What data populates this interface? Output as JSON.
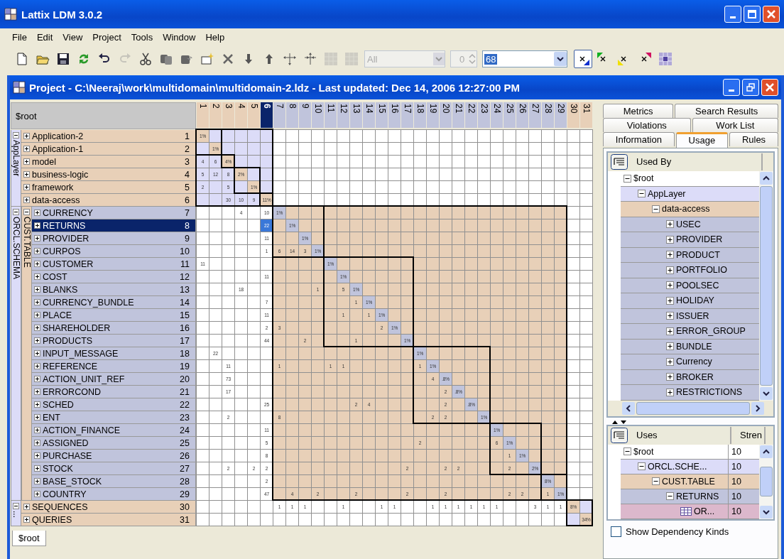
{
  "window": {
    "title": "Lattix LDM 3.0.2"
  },
  "menu": [
    "File",
    "Edit",
    "View",
    "Project",
    "Tools",
    "Window",
    "Help"
  ],
  "toolbar": [
    {
      "kind": "new",
      "disabled": false
    },
    {
      "kind": "open",
      "disabled": false
    },
    {
      "kind": "save",
      "disabled": false
    },
    {
      "kind": "refresh",
      "disabled": false
    },
    {
      "kind": "undo",
      "disabled": false
    },
    {
      "kind": "redo",
      "disabled": true
    },
    {
      "kind": "cut",
      "disabled": false
    },
    {
      "kind": "copy",
      "disabled": false
    },
    {
      "kind": "paste",
      "disabled": false
    },
    {
      "kind": "create",
      "disabled": false
    },
    {
      "kind": "delete",
      "disabled": false
    },
    {
      "kind": "down",
      "disabled": false
    },
    {
      "kind": "up",
      "disabled": false
    },
    {
      "kind": "spread",
      "disabled": false
    },
    {
      "kind": "squeeze",
      "disabled": false
    },
    {
      "kind": "grid",
      "disabled": true
    },
    {
      "kind": "grid",
      "disabled": true
    }
  ],
  "filter": {
    "value": "All",
    "disabled": true
  },
  "spinner": {
    "value": "0",
    "disabled": true
  },
  "combo": {
    "value": "68"
  },
  "marks": [
    {
      "kind": "blue",
      "pressed": true
    },
    {
      "kind": "green",
      "pressed": false
    },
    {
      "kind": "yellow",
      "pressed": false
    },
    {
      "kind": "pink",
      "pressed": false
    },
    {
      "kind": "partition",
      "pressed": false
    }
  ],
  "project_window": {
    "title": "Project - C:\\Neeraj\\work\\multidomain\\multidomain-2.ldz - Last updated: Dec 14, 2006 12:27:00 PM"
  },
  "matrix": {
    "root_label": "$root",
    "columns": [
      {
        "label": "1",
        "selected": false
      },
      {
        "label": "2",
        "selected": false
      },
      {
        "label": "3",
        "selected": false
      },
      {
        "label": "4",
        "selected": false
      },
      {
        "label": "5",
        "selected": false
      },
      {
        "label": "6",
        "selected": true
      },
      {
        "label": "7",
        "selected": false
      },
      {
        "label": "8",
        "selected": false
      },
      {
        "label": "9",
        "selected": false
      },
      {
        "label": "10",
        "selected": false
      },
      {
        "label": "11",
        "selected": false
      },
      {
        "label": "12",
        "selected": false
      },
      {
        "label": "13",
        "selected": false
      },
      {
        "label": "14",
        "selected": false
      },
      {
        "label": "15",
        "selected": false
      },
      {
        "label": "16",
        "selected": false
      },
      {
        "label": "17",
        "selected": false
      },
      {
        "label": "18",
        "selected": false
      },
      {
        "label": "19",
        "selected": false
      },
      {
        "label": "20",
        "selected": false
      },
      {
        "label": "21",
        "selected": false
      },
      {
        "label": "22",
        "selected": false
      },
      {
        "label": "23",
        "selected": false
      },
      {
        "label": "24",
        "selected": false
      },
      {
        "label": "25",
        "selected": false
      },
      {
        "label": "26",
        "selected": false
      },
      {
        "label": "27",
        "selected": false
      },
      {
        "label": "28",
        "selected": false
      },
      {
        "label": "29",
        "selected": false
      },
      {
        "label": "30",
        "selected": false
      },
      {
        "label": "31",
        "selected": false
      }
    ],
    "groups": [
      {
        "label": "AppLayer",
        "expanded": true,
        "blocks": [
          {
            "rows": [
              {
                "name": "Application-2",
                "number": "1",
                "selected": false,
                "expanded": false,
                "cells": [
                  "1%"
                ]
              },
              {
                "name": "Application-1",
                "number": "2",
                "selected": false,
                "expanded": false,
                "cells": [
                  null,
                  "1%"
                ]
              }
            ]
          },
          {
            "rows": [
              {
                "name": "model",
                "number": "3",
                "selected": false,
                "expanded": false,
                "cells": [
                  "4",
                  "6",
                  "4%"
                ]
              }
            ]
          },
          {
            "rows": [
              {
                "name": "business-logic",
                "number": "4",
                "selected": false,
                "expanded": false,
                "cells": [
                  "5",
                  "12",
                  "8",
                  "2%"
                ]
              },
              {
                "name": "framework",
                "number": "5",
                "selected": false,
                "expanded": false,
                "cells": [
                  "2",
                  null,
                  "5",
                  null,
                  "1%"
                ]
              }
            ]
          },
          {
            "rows": [
              {
                "name": "data-access",
                "number": "6",
                "selected": false,
                "expanded": false,
                "cells": [
                  null,
                  null,
                  "30",
                  "10",
                  "9",
                  "11%"
                ]
              }
            ]
          }
        ]
      },
      {
        "label": "ORCL.SCHEMA",
        "expanded": true,
        "children": [
          {
            "label": "CUST.TABLE",
            "expanded": true,
            "blocks": [
              {
                "rows": [
                  {
                    "name": "CURRENCY",
                    "number": "7",
                    "selected": false,
                    "expanded": false,
                    "cells": [
                      null,
                      null,
                      null,
                      "4",
                      null,
                      "10",
                      "1%"
                    ]
                  },
                  {
                    "name": "RETURNS",
                    "number": "8",
                    "selected": true,
                    "expanded": false,
                    "cells": [
                      null,
                      null,
                      null,
                      null,
                      null,
                      "22",
                      null,
                      "1%"
                    ]
                  },
                  {
                    "name": "PROVIDER",
                    "number": "9",
                    "selected": false,
                    "expanded": false,
                    "cells": [
                      null,
                      null,
                      null,
                      null,
                      null,
                      "11",
                      null,
                      null,
                      "1%"
                    ]
                  },
                  {
                    "name": "CURPOS",
                    "number": "10",
                    "selected": false,
                    "expanded": false,
                    "cells": [
                      null,
                      null,
                      null,
                      null,
                      null,
                      "1",
                      "6",
                      "14",
                      "3",
                      "1%"
                    ]
                  }
                ]
              },
              {
                "rows": [
                  {
                    "name": "CUSTOMER",
                    "number": "11",
                    "selected": false,
                    "expanded": false,
                    "cells": [
                      "11",
                      null,
                      null,
                      null,
                      null,
                      null,
                      null,
                      null,
                      null,
                      null,
                      "1%"
                    ]
                  },
                  {
                    "name": "COST",
                    "number": "12",
                    "selected": false,
                    "expanded": false,
                    "cells": [
                      null,
                      null,
                      null,
                      null,
                      null,
                      "11",
                      null,
                      null,
                      null,
                      null,
                      null,
                      "1%"
                    ]
                  },
                  {
                    "name": "BLANKS",
                    "number": "13",
                    "selected": false,
                    "expanded": false,
                    "cells": [
                      null,
                      null,
                      null,
                      "18",
                      null,
                      null,
                      null,
                      null,
                      null,
                      "1",
                      null,
                      "5",
                      "1%"
                    ]
                  },
                  {
                    "name": "CURRENCY_BUNDLE",
                    "number": "14",
                    "selected": false,
                    "expanded": false,
                    "cells": [
                      null,
                      null,
                      null,
                      null,
                      null,
                      "7",
                      null,
                      null,
                      null,
                      null,
                      null,
                      null,
                      "1",
                      "1%"
                    ]
                  },
                  {
                    "name": "PLACE",
                    "number": "15",
                    "selected": false,
                    "expanded": false,
                    "cells": [
                      null,
                      null,
                      null,
                      null,
                      null,
                      "11",
                      null,
                      null,
                      null,
                      null,
                      null,
                      "1",
                      null,
                      "1",
                      "1%"
                    ]
                  },
                  {
                    "name": "SHAREHOLDER",
                    "number": "16",
                    "selected": false,
                    "expanded": false,
                    "cells": [
                      null,
                      null,
                      null,
                      null,
                      null,
                      "2",
                      "3",
                      null,
                      null,
                      null,
                      null,
                      null,
                      null,
                      null,
                      "2",
                      "1%"
                    ]
                  },
                  {
                    "name": "PRODUCTS",
                    "number": "17",
                    "selected": false,
                    "expanded": false,
                    "cells": [
                      null,
                      null,
                      null,
                      null,
                      null,
                      "44",
                      null,
                      null,
                      "2",
                      null,
                      null,
                      null,
                      "1",
                      null,
                      null,
                      null,
                      "1%"
                    ]
                  }
                ]
              },
              {
                "rows": [
                  {
                    "name": "INPUT_MESSAGE",
                    "number": "18",
                    "selected": false,
                    "expanded": false,
                    "cells": [
                      null,
                      "22",
                      null,
                      null,
                      null,
                      null,
                      null,
                      null,
                      null,
                      null,
                      null,
                      null,
                      null,
                      null,
                      null,
                      null,
                      null,
                      "1%"
                    ]
                  },
                  {
                    "name": "REFERENCE",
                    "number": "19",
                    "selected": false,
                    "expanded": false,
                    "cells": [
                      null,
                      null,
                      "11",
                      null,
                      null,
                      null,
                      "1",
                      null,
                      null,
                      null,
                      "1",
                      "1",
                      null,
                      null,
                      null,
                      null,
                      null,
                      "1",
                      "1%"
                    ]
                  },
                  {
                    "name": "ACTION_UNIT_REF",
                    "number": "20",
                    "selected": false,
                    "expanded": false,
                    "cells": [
                      null,
                      null,
                      "73",
                      null,
                      null,
                      null,
                      null,
                      null,
                      null,
                      null,
                      null,
                      null,
                      null,
                      null,
                      null,
                      null,
                      null,
                      null,
                      "4",
                      ".8%"
                    ]
                  },
                  {
                    "name": "ERRORCOND",
                    "number": "21",
                    "selected": false,
                    "expanded": false,
                    "cells": [
                      null,
                      null,
                      "17",
                      null,
                      null,
                      null,
                      null,
                      null,
                      null,
                      null,
                      null,
                      null,
                      null,
                      null,
                      null,
                      null,
                      null,
                      null,
                      null,
                      "2",
                      ".8%"
                    ]
                  },
                  {
                    "name": "SCHED",
                    "number": "22",
                    "selected": false,
                    "expanded": false,
                    "cells": [
                      null,
                      null,
                      null,
                      null,
                      null,
                      "25",
                      null,
                      null,
                      null,
                      null,
                      null,
                      null,
                      "2",
                      "4",
                      null,
                      null,
                      null,
                      null,
                      null,
                      "2",
                      null,
                      ".8%"
                    ]
                  },
                  {
                    "name": "ENT",
                    "number": "23",
                    "selected": false,
                    "expanded": false,
                    "cells": [
                      null,
                      null,
                      "2",
                      null,
                      null,
                      null,
                      "8",
                      null,
                      null,
                      null,
                      null,
                      null,
                      null,
                      null,
                      null,
                      null,
                      null,
                      null,
                      "2",
                      "2",
                      null,
                      null,
                      "1%"
                    ]
                  }
                ]
              },
              {
                "rows": [
                  {
                    "name": "ACTION_FINANCE",
                    "number": "24",
                    "selected": false,
                    "expanded": false,
                    "cells": [
                      null,
                      null,
                      null,
                      null,
                      null,
                      "11",
                      null,
                      null,
                      null,
                      null,
                      null,
                      null,
                      null,
                      null,
                      null,
                      null,
                      null,
                      null,
                      null,
                      null,
                      null,
                      null,
                      null,
                      "1%"
                    ]
                  },
                  {
                    "name": "ASSIGNED",
                    "number": "25",
                    "selected": false,
                    "expanded": false,
                    "cells": [
                      null,
                      null,
                      null,
                      null,
                      null,
                      "5",
                      null,
                      null,
                      null,
                      null,
                      null,
                      null,
                      null,
                      null,
                      null,
                      null,
                      null,
                      "2",
                      null,
                      null,
                      null,
                      null,
                      null,
                      "6",
                      "1%"
                    ]
                  },
                  {
                    "name": "PURCHASE",
                    "number": "26",
                    "selected": false,
                    "expanded": false,
                    "cells": [
                      null,
                      null,
                      null,
                      null,
                      null,
                      "8",
                      null,
                      null,
                      null,
                      null,
                      null,
                      null,
                      null,
                      null,
                      null,
                      null,
                      null,
                      null,
                      null,
                      null,
                      null,
                      null,
                      null,
                      null,
                      "1",
                      "1%"
                    ]
                  },
                  {
                    "name": "STOCK",
                    "number": "27",
                    "selected": false,
                    "expanded": false,
                    "cells": [
                      null,
                      null,
                      "2",
                      null,
                      "2",
                      "2",
                      null,
                      null,
                      null,
                      null,
                      null,
                      null,
                      null,
                      null,
                      null,
                      null,
                      "2",
                      null,
                      null,
                      "2",
                      "2",
                      null,
                      null,
                      null,
                      "2",
                      null,
                      "2%"
                    ]
                  }
                ]
              },
              {
                "rows": [
                  {
                    "name": "BASE_STOCK",
                    "number": "28",
                    "selected": false,
                    "expanded": false,
                    "cells": [
                      null,
                      null,
                      null,
                      null,
                      null,
                      "2",
                      null,
                      null,
                      null,
                      null,
                      null,
                      null,
                      null,
                      null,
                      null,
                      null,
                      null,
                      null,
                      null,
                      null,
                      null,
                      null,
                      null,
                      null,
                      null,
                      null,
                      null,
                      "8%"
                    ]
                  },
                  {
                    "name": "COUNTRY",
                    "number": "29",
                    "selected": false,
                    "expanded": false,
                    "cells": [
                      null,
                      null,
                      null,
                      null,
                      null,
                      "47",
                      null,
                      "4",
                      null,
                      "2",
                      null,
                      null,
                      "2",
                      null,
                      null,
                      null,
                      "2",
                      null,
                      null,
                      "2",
                      null,
                      null,
                      null,
                      null,
                      "2",
                      "2",
                      null,
                      "1",
                      "1%"
                    ]
                  }
                ]
              }
            ]
          }
        ]
      },
      {
        "label": "...",
        "expanded": true,
        "blocks": [
          {
            "rows": [
              {
                "name": "SEQUENCES",
                "number": "30",
                "selected": false,
                "expanded": false,
                "cells": [
                  null,
                  null,
                  null,
                  null,
                  null,
                  null,
                  "1",
                  "1",
                  "1",
                  null,
                  null,
                  "1",
                  null,
                  null,
                  "1",
                  "1",
                  null,
                  null,
                  "1",
                  "1",
                  "1",
                  "1",
                  "1",
                  "1",
                  null,
                  null,
                  "3",
                  "1",
                  "1",
                  "8%"
                ]
              },
              {
                "name": "QUERIES",
                "number": "31",
                "selected": false,
                "expanded": false,
                "cells": [
                  null,
                  null,
                  null,
                  null,
                  null,
                  null,
                  null,
                  null,
                  null,
                  null,
                  null,
                  null,
                  null,
                  null,
                  null,
                  null,
                  null,
                  null,
                  null,
                  null,
                  null,
                  null,
                  null,
                  null,
                  null,
                  null,
                  null,
                  null,
                  null,
                  null,
                  "34%"
                ]
              }
            ]
          }
        ]
      }
    ]
  },
  "bottom_tabs": [
    {
      "label": "$root",
      "selected": true
    }
  ],
  "side_tabs": [
    {
      "tabs": [
        {
          "label": "Metrics",
          "selected": false
        },
        {
          "label": "Search Results",
          "selected": false
        }
      ]
    },
    {
      "tabs": [
        {
          "label": "Violations",
          "selected": false
        },
        {
          "label": "Work List",
          "selected": false
        }
      ]
    },
    {
      "tabs": [
        {
          "label": "Information",
          "selected": false
        },
        {
          "label": "Usage",
          "selected": true
        },
        {
          "label": "Rules",
          "selected": false
        }
      ]
    }
  ],
  "used_by": {
    "header": "Used By",
    "tree": [
      {
        "label": "$root",
        "expanded": true,
        "children": [
          {
            "label": "AppLayer",
            "expanded": true,
            "children": [
              {
                "label": "data-access",
                "expanded": true,
                "children": [
                  {
                    "label": "USEC",
                    "expanded": false
                  },
                  {
                    "label": "PROVIDER",
                    "expanded": false
                  },
                  {
                    "label": "PRODUCT",
                    "expanded": false
                  },
                  {
                    "label": "PORTFOLIO",
                    "expanded": false
                  },
                  {
                    "label": "POOLSEC",
                    "expanded": false
                  },
                  {
                    "label": "HOLIDAY",
                    "expanded": false
                  },
                  {
                    "label": "ISSUER",
                    "expanded": false
                  },
                  {
                    "label": "ERROR_GROUP",
                    "expanded": false
                  },
                  {
                    "label": "BUNDLE",
                    "expanded": false
                  },
                  {
                    "label": "Currency",
                    "expanded": false
                  },
                  {
                    "label": "BROKER",
                    "expanded": false
                  },
                  {
                    "label": "RESTRICTIONS",
                    "expanded": false
                  }
                ]
              }
            ]
          }
        ]
      }
    ]
  },
  "uses": {
    "columns": [
      "Uses",
      "Stren"
    ],
    "tree": [
      {
        "label": "$root",
        "strength": "10",
        "expanded": true,
        "children": [
          {
            "label": "ORCL.SCHE...",
            "strength": "10",
            "expanded": true,
            "children": [
              {
                "label": "CUST.TABLE",
                "strength": "10",
                "expanded": true,
                "children": [
                  {
                    "label": "RETURNS",
                    "strength": "10",
                    "expanded": true,
                    "children": [
                      {
                        "label": "OR...",
                        "strength": "10"
                      }
                    ]
                  }
                ]
              }
            ]
          }
        ]
      }
    ]
  },
  "show_dependency_kinds": {
    "label": "Show Dependency Kinds",
    "checked": false
  }
}
